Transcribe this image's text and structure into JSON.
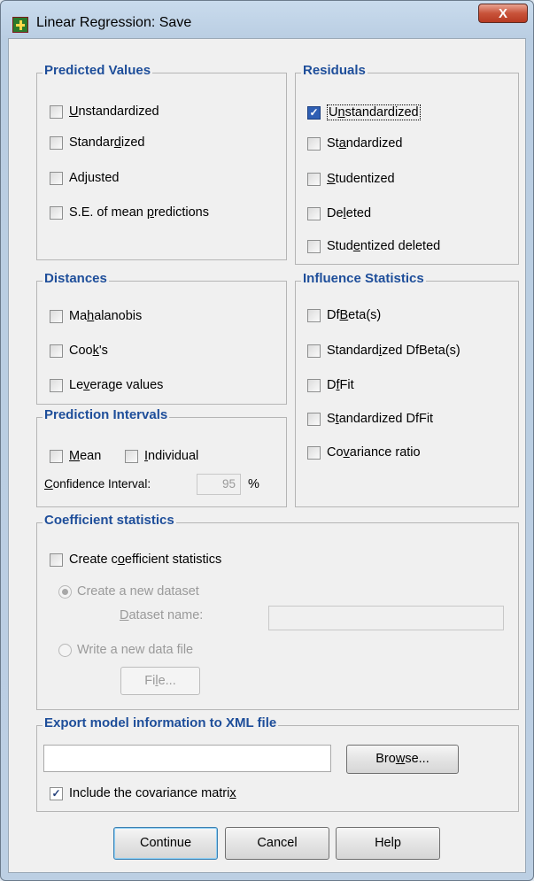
{
  "window": {
    "title": "Linear Regression: Save",
    "close_glyph": "X",
    "icon": "spss-app-icon"
  },
  "predicted": {
    "legend": "Predicted Values",
    "items": [
      {
        "pre": "",
        "u": "U",
        "post": "nstandardized",
        "checked": false
      },
      {
        "pre": "Standar",
        "u": "d",
        "post": "ized",
        "checked": false
      },
      {
        "pre": "Ad",
        "u": "j",
        "post": "usted",
        "checked": false
      },
      {
        "pre": "S.E. of mean ",
        "u": "p",
        "post": "redictions",
        "checked": false
      }
    ]
  },
  "residuals": {
    "legend": "Residuals",
    "items": [
      {
        "pre": "U",
        "u": "n",
        "post": "standardized",
        "checked": true
      },
      {
        "pre": "St",
        "u": "a",
        "post": "ndardized",
        "checked": false
      },
      {
        "pre": "",
        "u": "S",
        "post": "tudentized",
        "checked": false
      },
      {
        "pre": "De",
        "u": "l",
        "post": "eted",
        "checked": false
      },
      {
        "pre": "Stud",
        "u": "e",
        "post": "ntized deleted",
        "checked": false
      }
    ]
  },
  "distances": {
    "legend": "Distances",
    "items": [
      {
        "pre": "Ma",
        "u": "h",
        "post": "alanobis",
        "checked": false
      },
      {
        "pre": "Coo",
        "u": "k",
        "post": "'s",
        "checked": false
      },
      {
        "pre": "Le",
        "u": "v",
        "post": "erage values",
        "checked": false
      }
    ]
  },
  "influence": {
    "legend": "Influence Statistics",
    "items": [
      {
        "pre": "Df",
        "u": "B",
        "post": "eta(s)",
        "checked": false
      },
      {
        "pre": "Standard",
        "u": "i",
        "post": "zed DfBeta(s)",
        "checked": false
      },
      {
        "pre": "D",
        "u": "f",
        "post": "Fit",
        "checked": false
      },
      {
        "pre": "S",
        "u": "t",
        "post": "andardized DfFit",
        "checked": false
      },
      {
        "pre": "Co",
        "u": "v",
        "post": "ariance ratio",
        "checked": false
      }
    ]
  },
  "intervals": {
    "legend": "Prediction Intervals",
    "mean": {
      "pre": "",
      "u": "M",
      "post": "ean",
      "checked": false
    },
    "individual": {
      "pre": "",
      "u": "I",
      "post": "ndividual",
      "checked": false
    },
    "ci_label_u": "C",
    "ci_label_post": "onfidence Interval:",
    "ci_value": "95",
    "ci_unit": "%"
  },
  "coefficient": {
    "legend": "Coefficient statistics",
    "create": {
      "pre": "Create c",
      "u": "o",
      "post": "efficient statistics",
      "checked": false
    },
    "new_dataset": "Create a new dataset",
    "dataset_name_u": "D",
    "dataset_name_post": "ataset name:",
    "write_file": "Write a new data file",
    "file_btn_pre": "Fi",
    "file_btn_u": "l",
    "file_btn_post": "e..."
  },
  "export": {
    "legend": "Export model information to XML file",
    "path_value": "",
    "browse_pre": "Bro",
    "browse_u": "w",
    "browse_post": "se...",
    "include": {
      "pre": "Include the covariance matri",
      "u": "x",
      "post": "",
      "checked": true
    }
  },
  "buttons": {
    "continue": "Continue",
    "cancel": "Cancel",
    "help": "Help"
  }
}
